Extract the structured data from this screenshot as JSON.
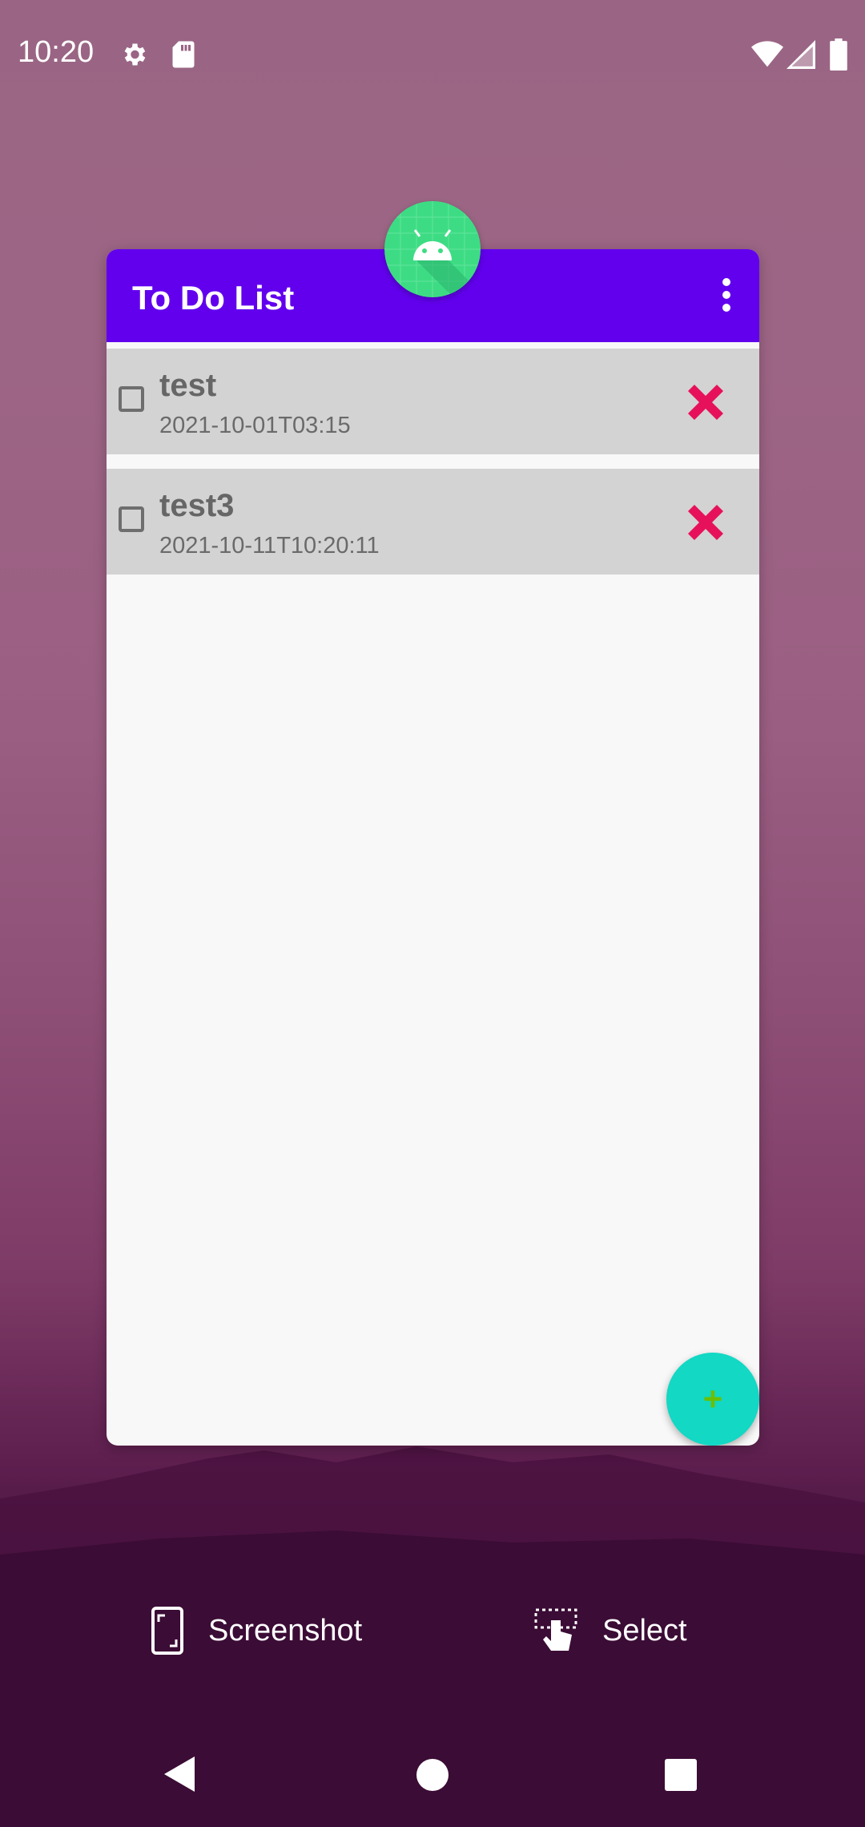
{
  "status_bar": {
    "time": "10:20",
    "icons": [
      "settings-icon",
      "sd-card-icon",
      "wifi-icon",
      "signal-icon",
      "battery-icon"
    ]
  },
  "app": {
    "title": "To Do List",
    "header_color": "#6200ee",
    "todos": [
      {
        "title": "test",
        "date": "2021-10-01T03:15",
        "checked": false
      },
      {
        "title": "test3",
        "date": "2021-10-11T10:20:11",
        "checked": false
      }
    ],
    "fab_icon": "plus-icon",
    "fab_color": "#12d8c4"
  },
  "recents_actions": {
    "screenshot_label": "Screenshot",
    "select_label": "Select"
  },
  "nav": [
    "back-icon",
    "home-icon",
    "recents-icon"
  ]
}
